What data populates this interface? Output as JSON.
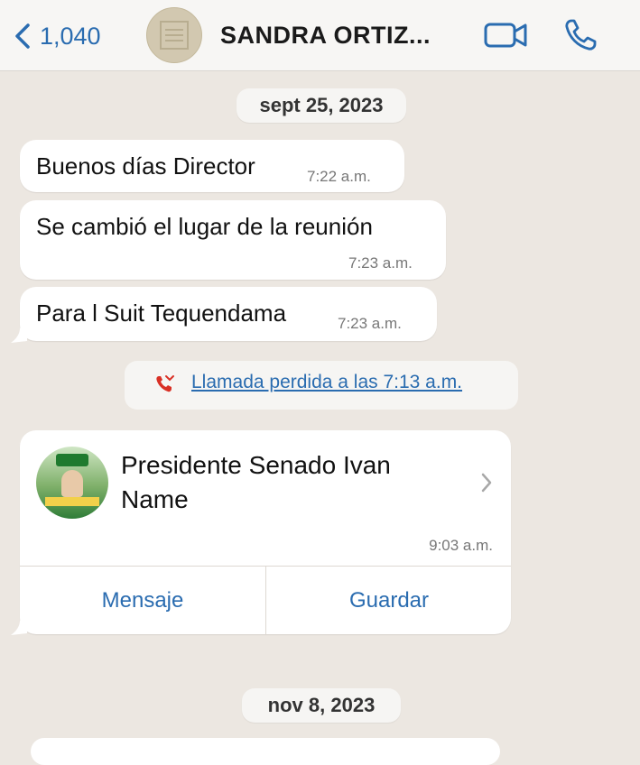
{
  "header": {
    "back_count": "1,040",
    "contact_title": "SANDRA ORTIZ...",
    "back_icon": "chevron-left-icon",
    "video_icon": "video-call-icon",
    "phone_icon": "phone-call-icon",
    "accent_color": "#2A6CB0"
  },
  "chat": {
    "dates": [
      "sept 25, 2023",
      "nov 8, 2023"
    ],
    "messages": [
      {
        "text": "Buenos días Director",
        "time": "7:22 a.m."
      },
      {
        "text": "Se cambió el lugar de la reunión",
        "time": "7:23 a.m."
      },
      {
        "text": "Para l Suit Tequendama",
        "time": "7:23 a.m."
      }
    ],
    "missed_call": {
      "text": "Llamada perdida a las 7:13 a.m.",
      "icon": "missed-call-icon",
      "icon_color": "#D93025"
    },
    "contact_card": {
      "name": "Presidente Senado Ivan Name",
      "time": "9:03 a.m.",
      "actions": [
        "Mensaje",
        "Guardar"
      ]
    }
  },
  "colors": {
    "background": "#ECE7E1",
    "bubble": "#FFFFFF",
    "link": "#2A6CB0"
  }
}
